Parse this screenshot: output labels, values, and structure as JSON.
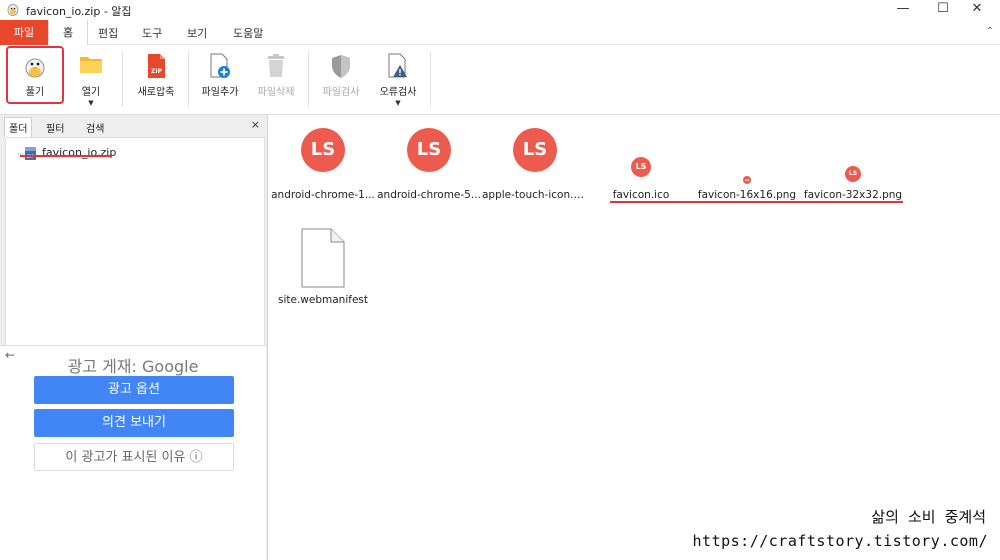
{
  "window": {
    "title": "favicon_io.zip - 알집",
    "minimize_glyph": "—",
    "maximize_glyph": "☐",
    "close_glyph": "✕"
  },
  "ribbon_tabs": [
    "파일",
    "홈",
    "편집",
    "도구",
    "보기",
    "도움말"
  ],
  "ribbon_tools": {
    "extract": "풀기",
    "open": "열기",
    "new_compress": "새로압축",
    "add_file": "파일추가",
    "delete_file": "파일삭제",
    "scan_file": "파일검사",
    "error_check": "오류검사"
  },
  "panel": {
    "tabs": [
      "폴더",
      "필터",
      "검색"
    ],
    "close_glyph": "×",
    "tree_item": "favicon_io.zip"
  },
  "ad": {
    "title": "광고 게재: Google",
    "options": "광고 옵션",
    "feedback": "의견 보내기",
    "why": "이 광고가 표시된 이유 ⓘ"
  },
  "files": [
    {
      "name": "android-chrome-1...",
      "icon": "ls-logo"
    },
    {
      "name": "android-chrome-5...",
      "icon": "ls-logo"
    },
    {
      "name": "apple-touch-icon.p...",
      "icon": "ls-logo"
    },
    {
      "name": "favicon.ico",
      "icon": "ls-logo"
    },
    {
      "name": "favicon-16x16.png",
      "icon": "ls-logo"
    },
    {
      "name": "favicon-32x32.png",
      "icon": "ls-logo"
    },
    {
      "name": "site.webmanifest",
      "icon": "blank-document"
    }
  ],
  "logo_text": "LS",
  "watermark": {
    "line1": "삶의 소비 중계석",
    "line2": "https://craftstory.tistory.com/"
  },
  "colors": {
    "accent": "#e8472b",
    "highlight": "#e0353f",
    "logo": "#ec5b4e",
    "google_blue": "#4285f4"
  }
}
